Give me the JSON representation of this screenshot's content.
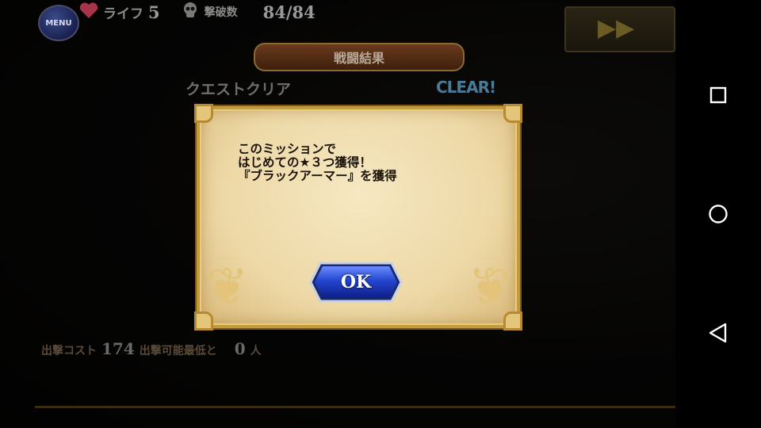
{
  "hud": {
    "menu_label": "MENU",
    "life_label": "ライフ",
    "life_value": "5",
    "kills_label": "撃破数",
    "kills_value": "84/84"
  },
  "results": {
    "banner_title": "戦闘結果",
    "quest_clear_label": "クエストクリア",
    "clear_badge": "CLEAR!",
    "footer_label_1": "出撃コスト",
    "footer_value_1": "174",
    "footer_label_2": "出撃可能最低と",
    "footer_value_2": "0",
    "footer_unit": "人"
  },
  "dialog": {
    "message_lines": [
      "このミッションで",
      "はじめての★３つ獲得！",
      "『ブラックアーマー』を獲得"
    ],
    "ok_label": "OK"
  },
  "colors": {
    "dialog_parchment": "#f2e2b6",
    "dialog_border": "#c49a3e",
    "ok_button_blue": "#1f3fc0"
  },
  "icons": [
    "heart-icon",
    "skull-icon",
    "fast-forward-icon",
    "recent-apps-icon",
    "home-icon",
    "back-icon"
  ]
}
